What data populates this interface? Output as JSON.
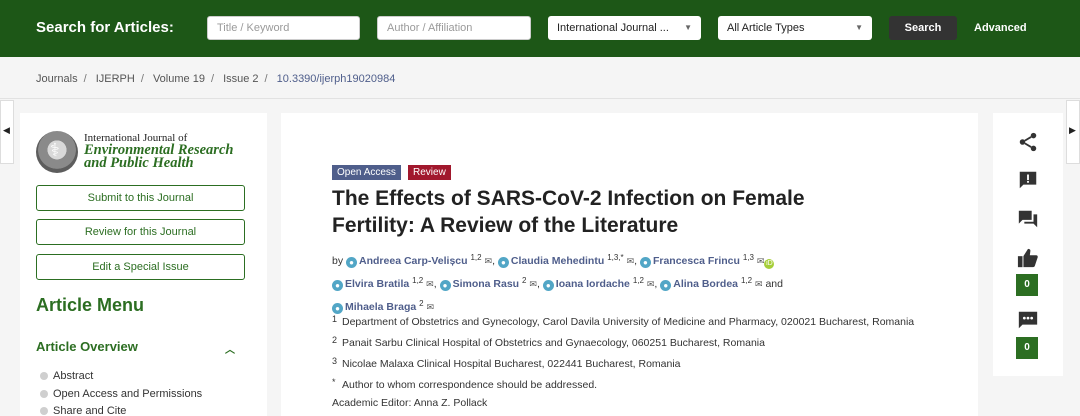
{
  "search": {
    "title": "Search for Articles:",
    "keyword_placeholder": "Title / Keyword",
    "author_placeholder": "Author / Affiliation",
    "journal_select": "International Journal ...",
    "type_select": "All Article Types",
    "search_label": "Search",
    "advanced_label": "Advanced"
  },
  "breadcrumb": [
    "Journals",
    "IJERPH",
    "Volume 19",
    "Issue 2",
    "10.3390/ijerph19020984"
  ],
  "sidebar": {
    "journal_name_line1": "International Journal of",
    "journal_name_line2": "Environmental Research",
    "journal_name_line3": "and Public Health",
    "buttons": [
      "Submit to this Journal",
      "Review for this Journal",
      "Edit a Special Issue"
    ],
    "menu_title": "Article Menu",
    "overview_title": "Article Overview",
    "items": [
      "Abstract",
      "Open Access and Permissions",
      "Share and Cite"
    ]
  },
  "article": {
    "badges": {
      "open_access": "Open Access",
      "type": "Review"
    },
    "title": "The Effects of SARS-CoV-2 Infection on Female Fertility: A Review of the Literature",
    "by": "by",
    "authors": [
      {
        "name": "Andreea Carp-Velișcu",
        "sup": "1,2"
      },
      {
        "name": "Claudia Mehedintu",
        "sup": "1,3,*"
      },
      {
        "name": "Francesca Frincu",
        "sup": "1,3"
      },
      {
        "name": "Elvira Bratila",
        "sup": "1,2"
      },
      {
        "name": "Simona Rasu",
        "sup": "2"
      },
      {
        "name": "Ioana Iordache",
        "sup": "1,2"
      },
      {
        "name": "Alina Bordea",
        "sup": "1,2"
      },
      {
        "name": "Mihaela Braga",
        "sup": "2"
      }
    ],
    "and": "and",
    "affiliations": [
      {
        "num": "1",
        "text": "Department of Obstetrics and Gynecology, Carol Davila University of Medicine and Pharmacy, 020021 Bucharest, Romania"
      },
      {
        "num": "2",
        "text": "Panait Sarbu Clinical Hospital of Obstetrics and Gynaecology, 060251 Bucharest, Romania"
      },
      {
        "num": "3",
        "text": "Nicolae Malaxa Clinical Hospital Bucharest, 022441 Bucharest, Romania"
      },
      {
        "num": "*",
        "text": "Author to whom correspondence should be addressed."
      }
    ],
    "editor": "Academic Editor: Anna Z. Pollack"
  },
  "actions": {
    "icons": [
      "share-icon",
      "report-icon",
      "comments-icon",
      "like-icon",
      "comment-count-icon"
    ],
    "like_count": "0",
    "comment_count": "0"
  },
  "colors": {
    "brand_green": "#1d5717",
    "accent_green": "#2c6e22",
    "link_blue": "#4f5e8b",
    "review_red": "#a1182d"
  }
}
